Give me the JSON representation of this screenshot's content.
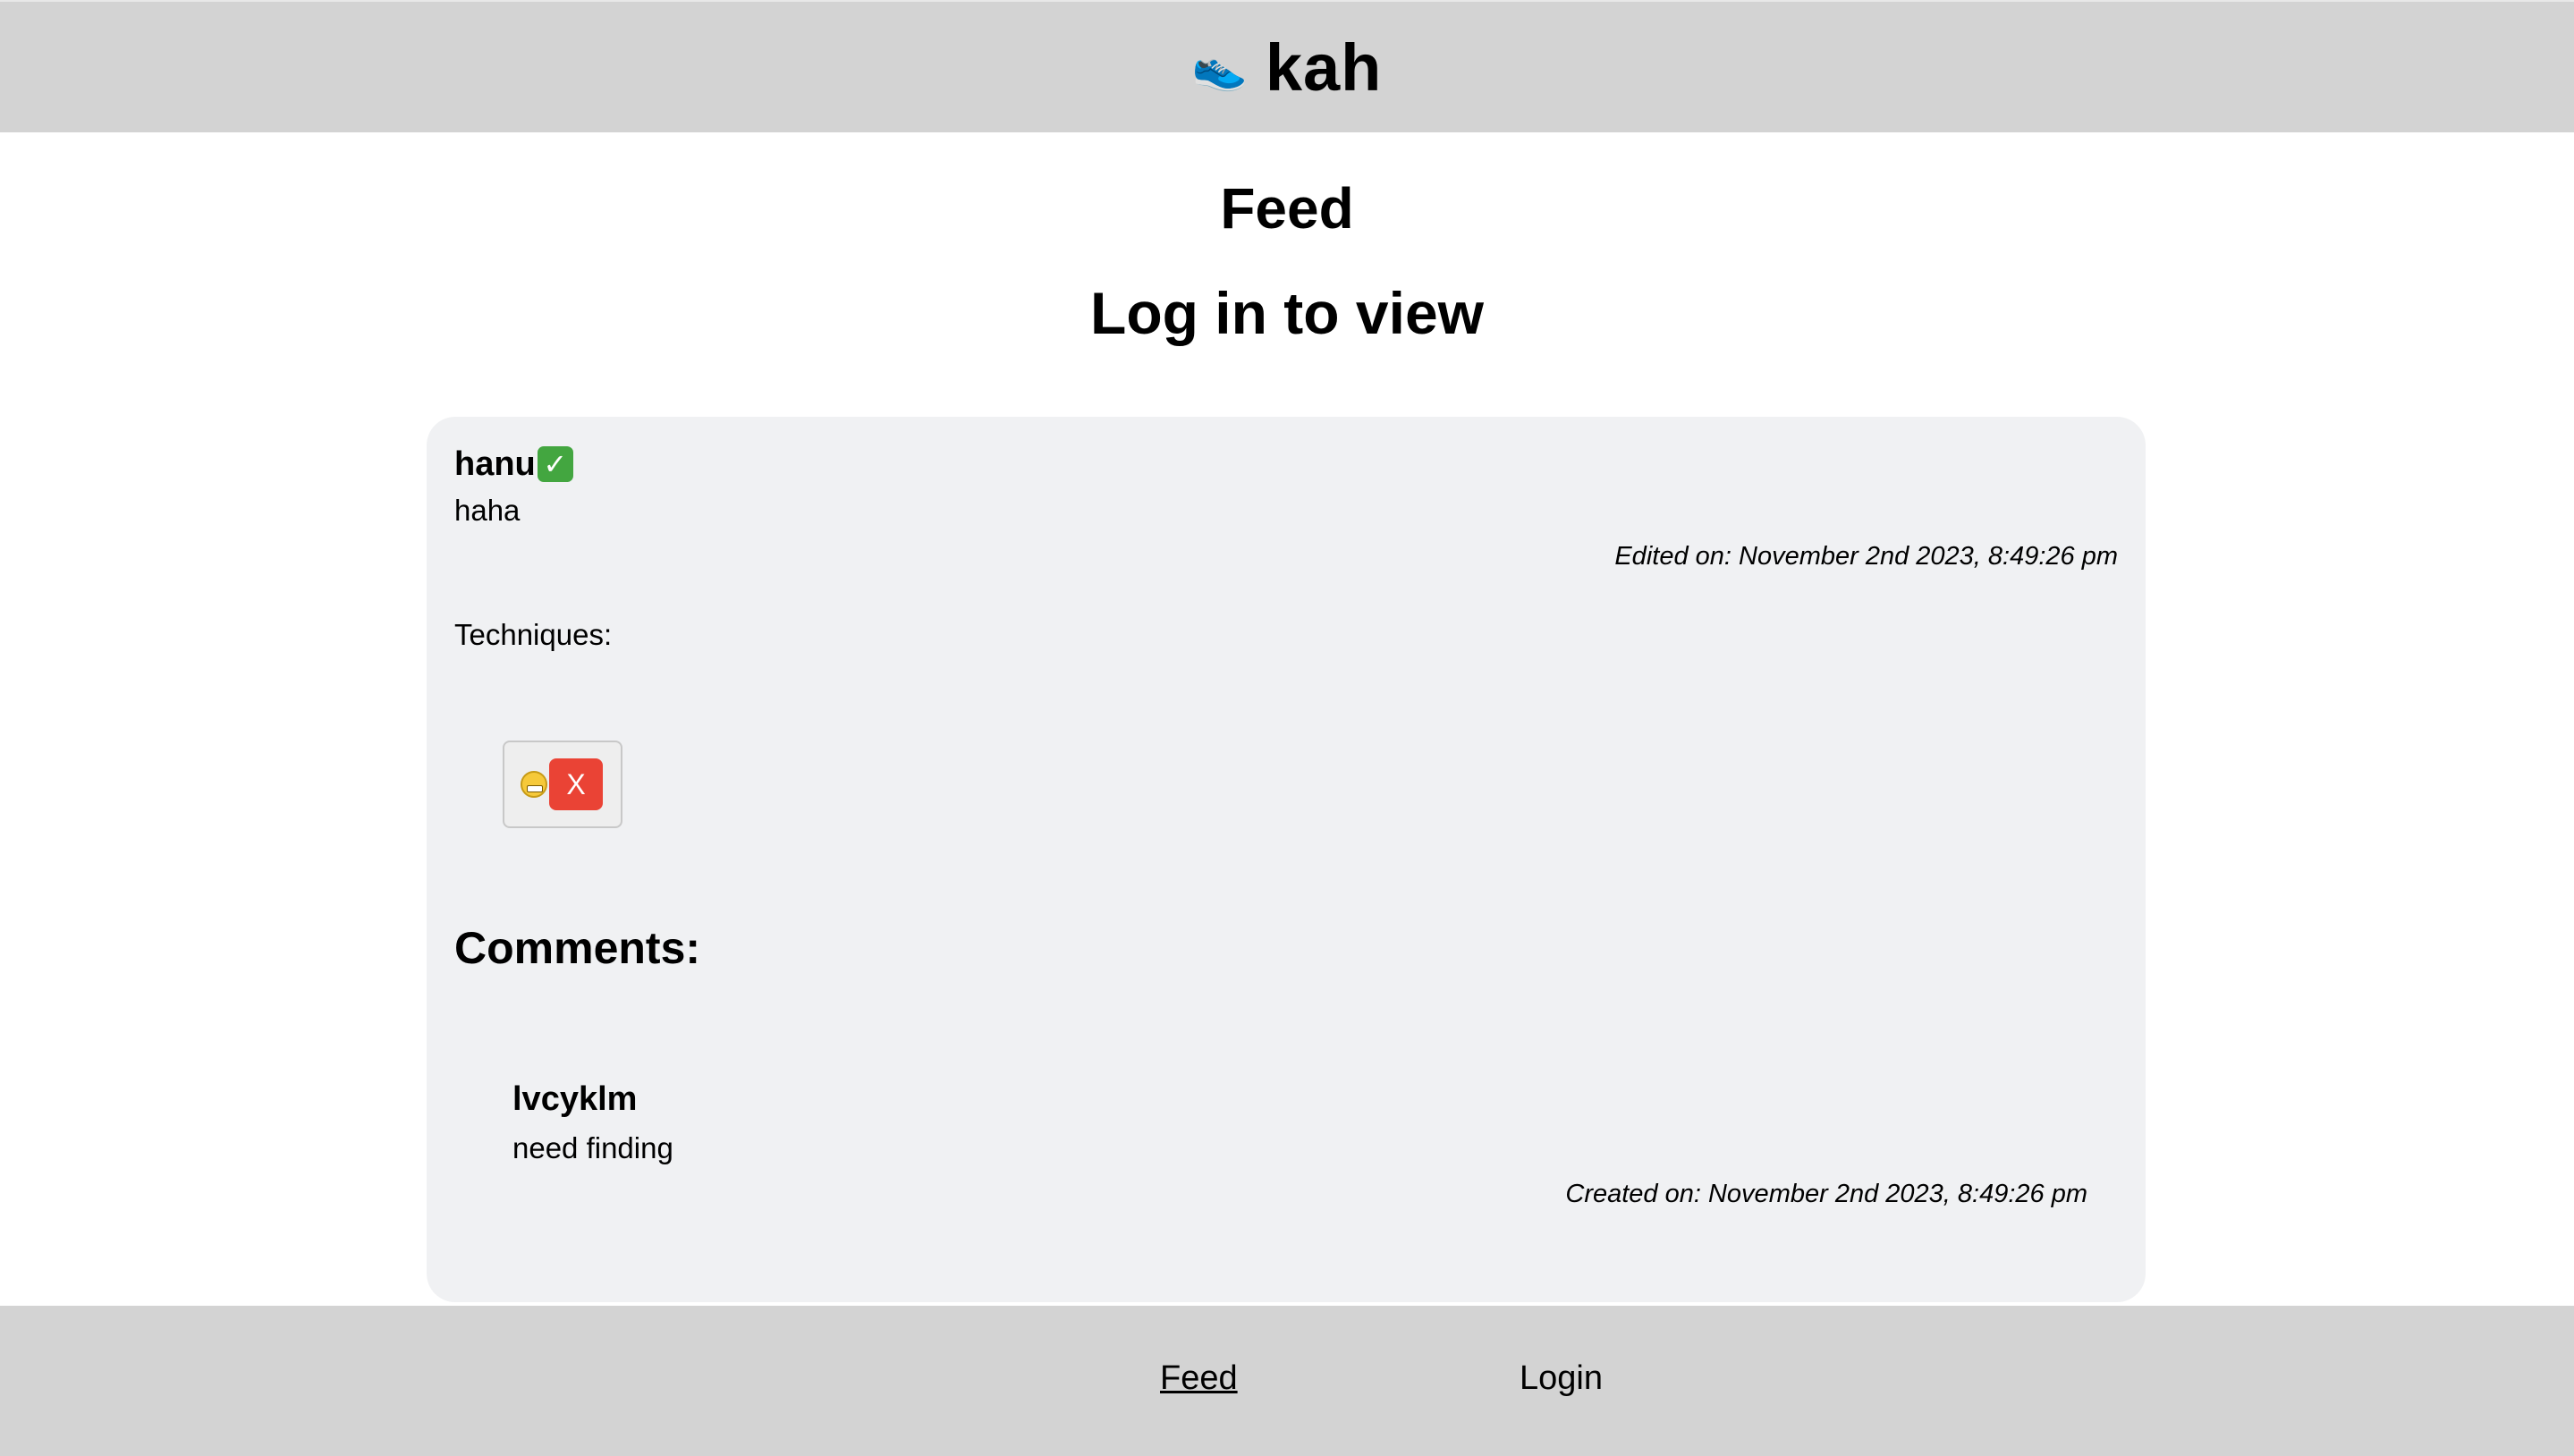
{
  "header": {
    "logo_icon": "running-shoe-icon",
    "logo_glyph": "👟",
    "app_title": "kah",
    "background": "#d3d3d3"
  },
  "main": {
    "page_title": "Feed",
    "subtitle": "Log in to view"
  },
  "post": {
    "author": "hanu",
    "verified_icon": "check-mark-icon",
    "verified_glyph": "✓",
    "body": "haha",
    "edited": "Edited on: November 2nd 2023, 8:49:26 pm",
    "techniques_label": "Techniques:",
    "techniques": [
      {
        "icon": "grinning-face-icon",
        "remove_label": "X"
      }
    ],
    "comments_heading": "Comments:",
    "comments": [
      {
        "author": "lvcyklm",
        "body": "need finding",
        "created": "Created on: November 2nd 2023, 8:49:26 pm"
      }
    ]
  },
  "footer": {
    "nav": [
      {
        "label": "Feed",
        "active": true
      },
      {
        "label": "Login",
        "active": false
      }
    ]
  },
  "colors": {
    "card_background": "#f0f1f3",
    "remove_button": "#ea4335",
    "verified_badge": "#43a640"
  }
}
